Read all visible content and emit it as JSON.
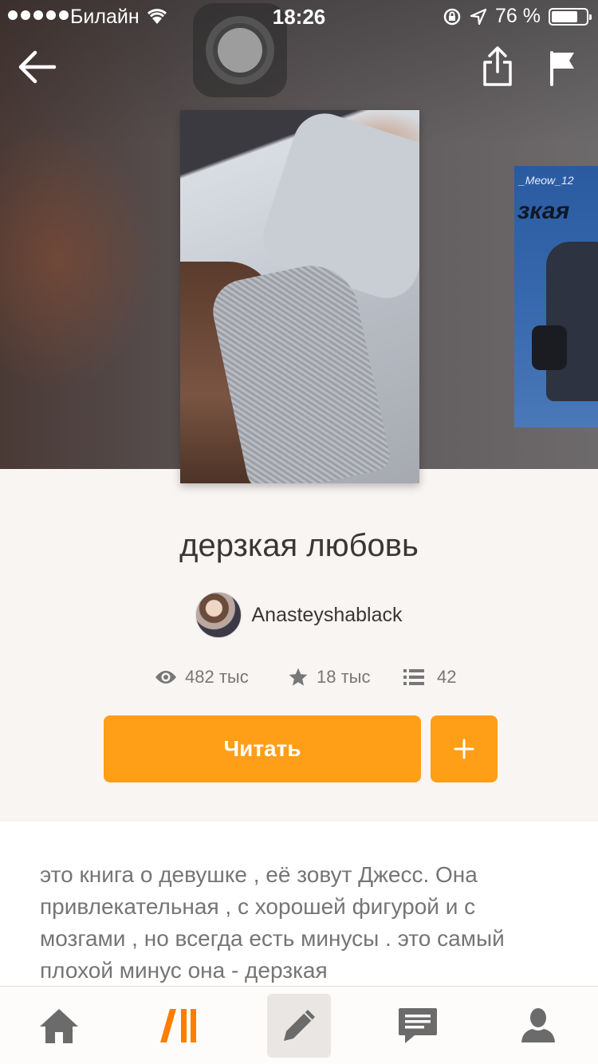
{
  "status_bar": {
    "carrier": "Билайн",
    "time": "18:26",
    "battery_percent": "76 %",
    "battery_level": 0.76
  },
  "nav": {
    "back_icon": "arrow-left-icon",
    "share_icon": "share-icon",
    "report_icon": "flag-icon"
  },
  "side_cover": {
    "top_text": "_Meow_12",
    "word": "зкая"
  },
  "story": {
    "title": "дерзкая любовь",
    "author": "Anasteyshablack",
    "views": "482 тыс",
    "votes": "18 тыс",
    "parts": "42",
    "description": "это книга о девушке , её зовут Джесс. Она привлекательная , с хорошей фигурой и с мозгами , но всегда есть минусы . это самый плохой минус она - дерзкая"
  },
  "actions": {
    "read_label": "Читать",
    "add_label": "+"
  },
  "tabbar": {
    "items": [
      "home-icon",
      "browse-icon",
      "write-icon",
      "messages-icon",
      "profile-icon"
    ],
    "active_color": "#ff7d00",
    "icon_color": "#6b6b6b"
  },
  "colors": {
    "accent": "#ff9e17",
    "title": "#3a3633",
    "meta": "#777777"
  }
}
